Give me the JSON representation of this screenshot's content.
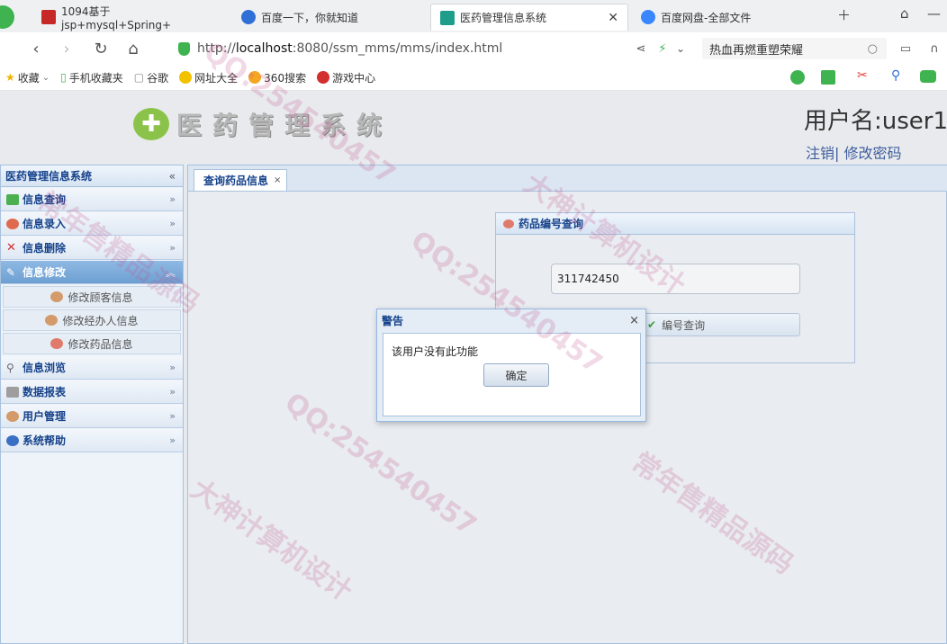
{
  "browser": {
    "tabs": [
      {
        "label": "1094基于jsp+mysql+Spring+",
        "active": false
      },
      {
        "label": "百度一下，你就知道",
        "active": false
      },
      {
        "label": "医药管理信息系统",
        "active": true
      },
      {
        "label": "百度网盘-全部文件",
        "active": false
      }
    ],
    "url_prefix": "http://",
    "url_host": "localhost",
    "url_rest": ":8080/ssm_mms/mms/index.html",
    "hot_search": "热血再燃重塑荣耀"
  },
  "bookmarks": [
    {
      "label": "收藏",
      "icon": "star-icon"
    },
    {
      "label": "手机收藏夹",
      "icon": "phone-icon"
    },
    {
      "label": "谷歌",
      "icon": "page-icon"
    },
    {
      "label": "网址大全",
      "icon": "navigation-icon"
    },
    {
      "label": "360搜索",
      "icon": "search360-icon"
    },
    {
      "label": "游戏中心",
      "icon": "game-icon"
    }
  ],
  "header": {
    "system_title": "医药管理系统",
    "username": "用户名:user1",
    "logout": "注销",
    "separator": "|",
    "change_password": "修改密码"
  },
  "sidebar": {
    "title": "医药管理信息系统",
    "collapse": "«",
    "items": [
      {
        "label": "信息查询",
        "icon": "query-icon"
      },
      {
        "label": "信息录入",
        "icon": "input-icon"
      },
      {
        "label": "信息删除",
        "icon": "delete-icon"
      },
      {
        "label": "信息修改",
        "icon": "edit-icon",
        "expanded": true
      },
      {
        "label": "信息浏览",
        "icon": "browse-icon"
      },
      {
        "label": "数据报表",
        "icon": "report-icon"
      },
      {
        "label": "用户管理",
        "icon": "user-icon"
      },
      {
        "label": "系统帮助",
        "icon": "help-icon"
      }
    ],
    "subitems": [
      {
        "label": "修改顾客信息"
      },
      {
        "label": "修改经办人信息"
      },
      {
        "label": "修改药品信息"
      }
    ],
    "chevron": "»"
  },
  "main": {
    "tab_label": "查询药品信息",
    "tab_close": "×",
    "panel_title": "药品编号查询",
    "id_value": "311742450",
    "query_button": "编号查询"
  },
  "dialog": {
    "title": "警告",
    "close": "×",
    "message": "该用户没有此功能",
    "ok": "确定"
  },
  "watermarks": [
    "QQ:2545404​57",
    "大神计算机设计",
    "常年售精品源码"
  ]
}
